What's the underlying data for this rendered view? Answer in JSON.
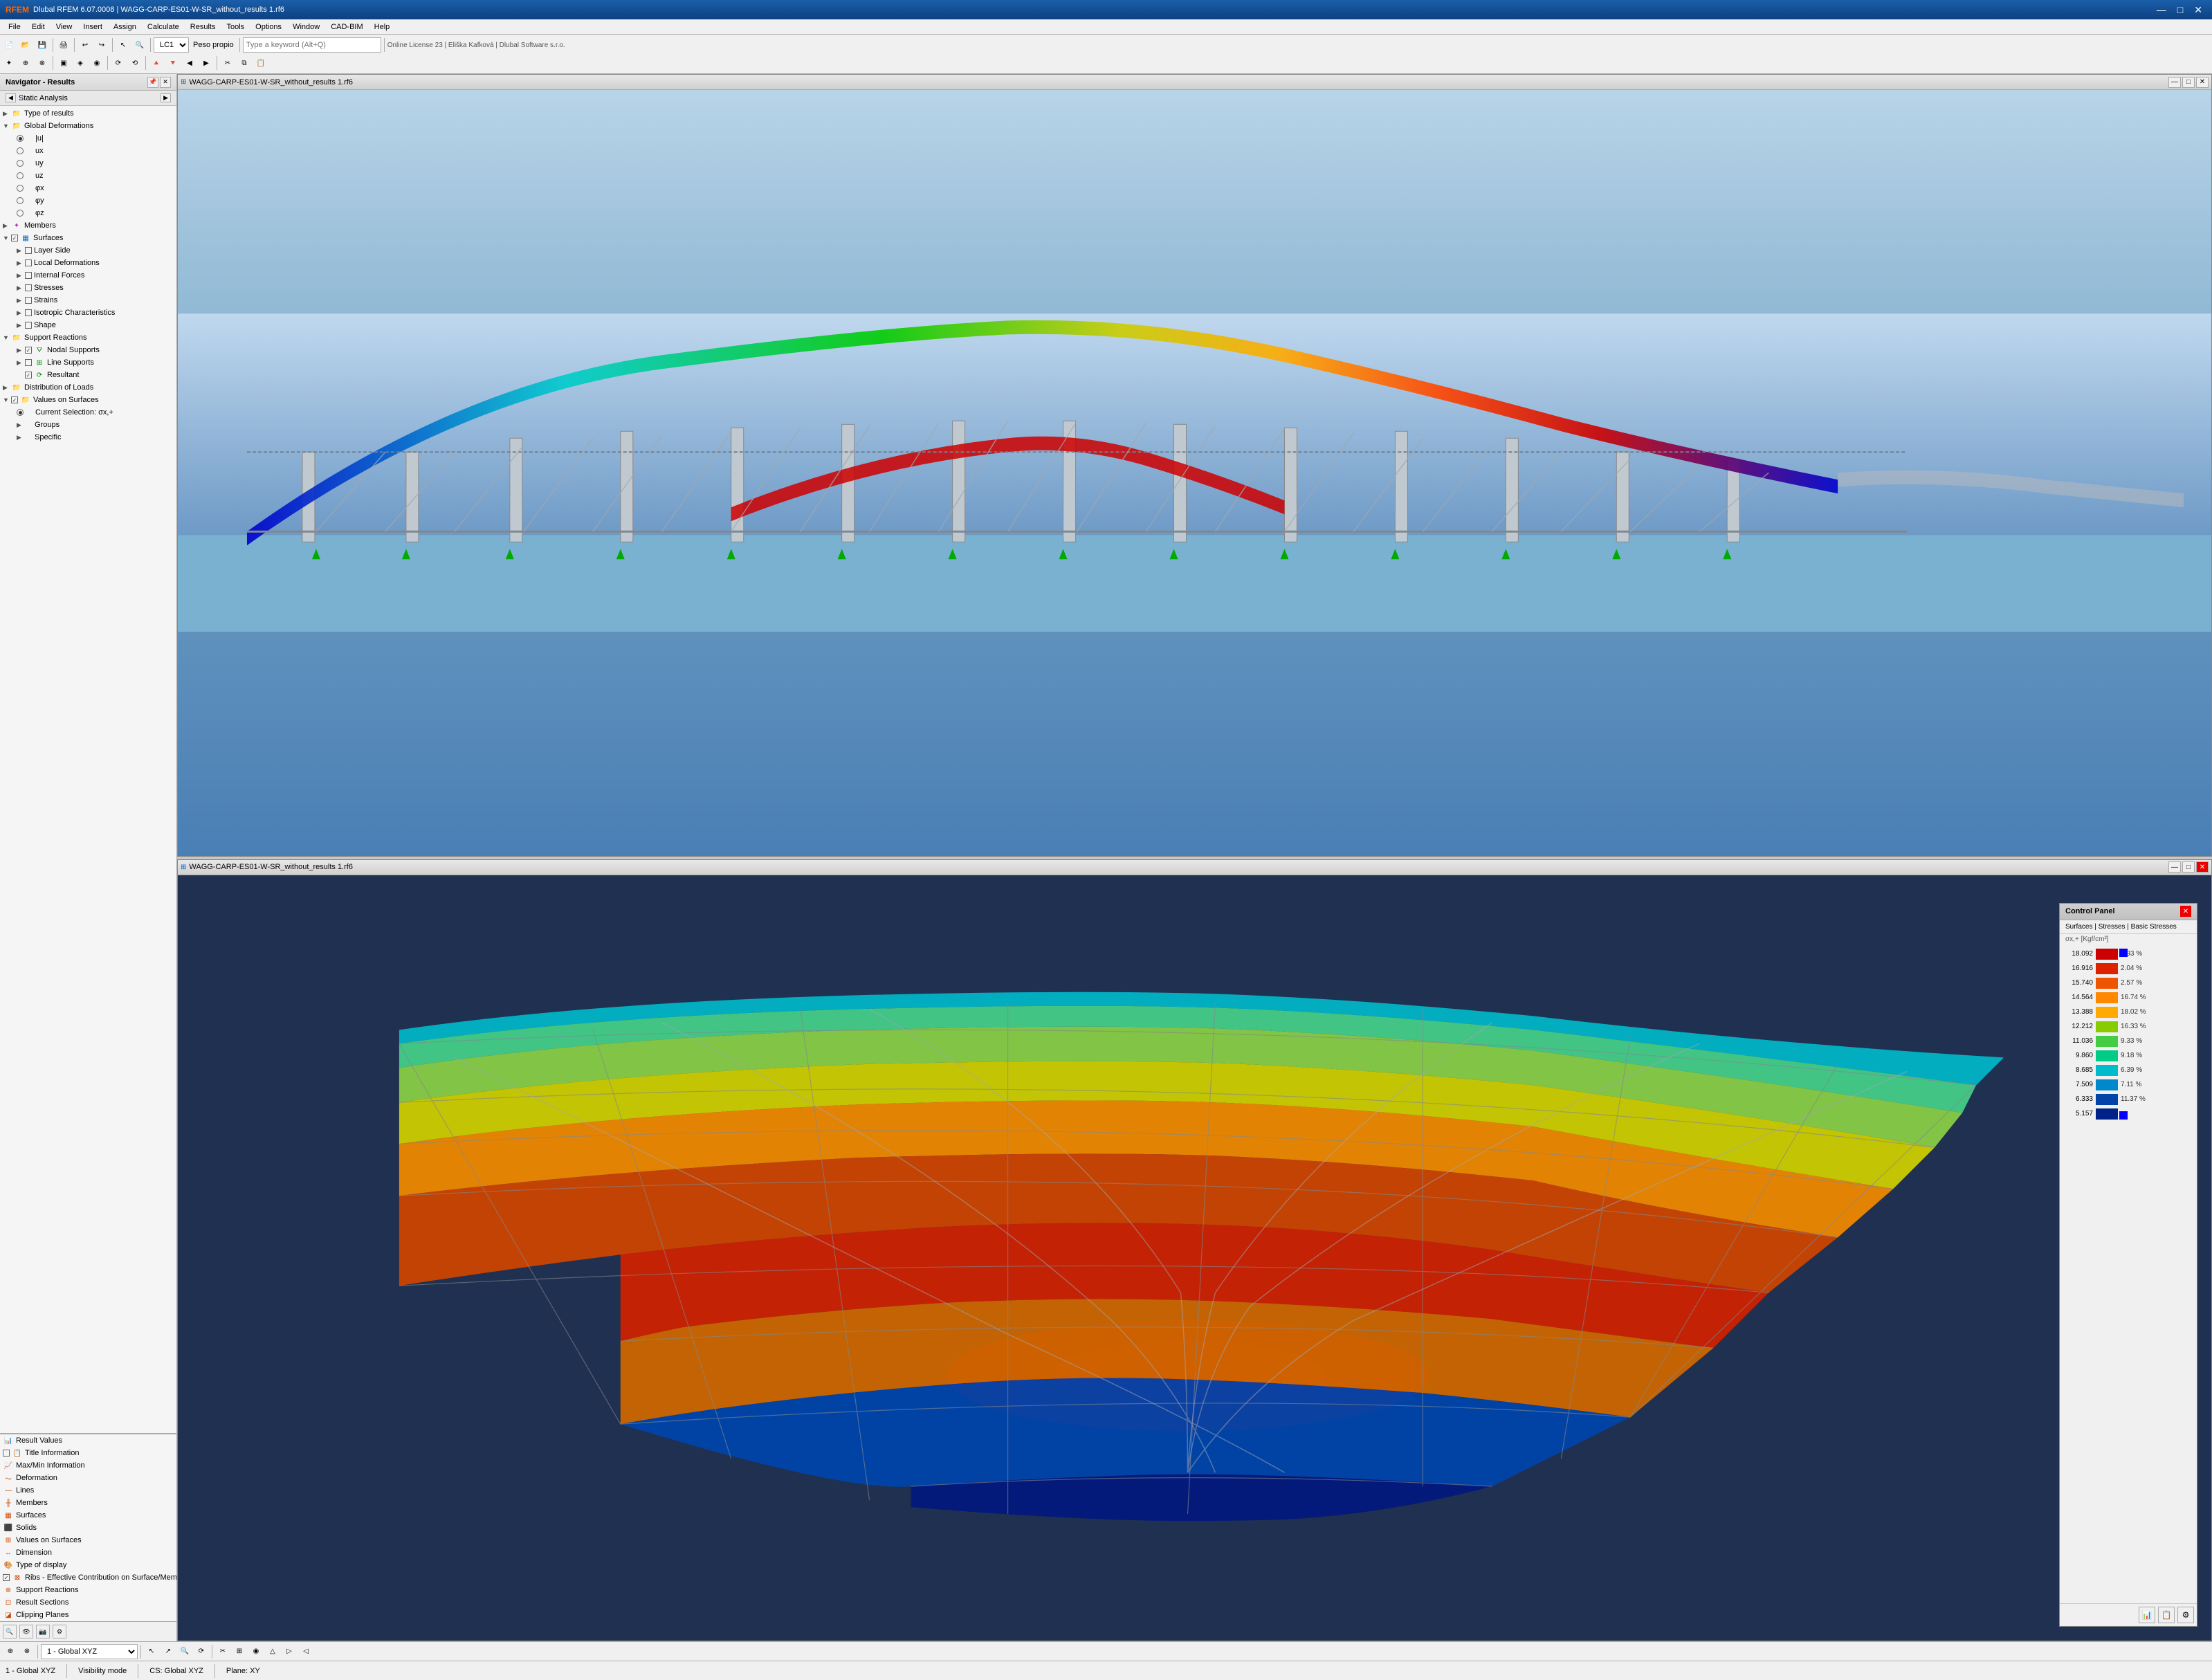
{
  "titleBar": {
    "icon": "🔷",
    "title": "Dlubal RFEM 6.07.0008 | WAGG-CARP-ES01-W-SR_without_results 1.rf6",
    "minimize": "—",
    "maximize": "□",
    "close": "✕"
  },
  "menuBar": {
    "items": [
      "File",
      "Edit",
      "View",
      "Insert",
      "Assign",
      "Calculate",
      "Results",
      "Tools",
      "Options",
      "Window",
      "CAD-BIM",
      "Help"
    ]
  },
  "toolbar": {
    "loadCase": "LC1",
    "loadCaseLabel": "Peso propio",
    "searchPlaceholder": "Type a keyword (Alt+Q)",
    "licenseInfo": "Online License 23 | Eliška Kafková | Dlubal Software s.r.o."
  },
  "navigator": {
    "title": "Navigator - Results",
    "subTitle": "Static Analysis",
    "tree": [
      {
        "id": "type-of-results",
        "label": "Type of results",
        "level": 0,
        "arrow": "▶",
        "hasIcon": true,
        "iconType": "folder"
      },
      {
        "id": "global-deformations",
        "label": "Global Deformations",
        "level": 0,
        "arrow": "▼",
        "hasIcon": true,
        "iconType": "folder",
        "expanded": true
      },
      {
        "id": "deform-u",
        "label": "|u|",
        "level": 1,
        "radio": true,
        "checked": true
      },
      {
        "id": "deform-ux",
        "label": "ux",
        "level": 1,
        "radio": true,
        "checked": false
      },
      {
        "id": "deform-uy",
        "label": "uy",
        "level": 1,
        "radio": true,
        "checked": false
      },
      {
        "id": "deform-uz",
        "label": "uz",
        "level": 1,
        "radio": true,
        "checked": false
      },
      {
        "id": "deform-px",
        "label": "φx",
        "level": 1,
        "radio": true,
        "checked": false
      },
      {
        "id": "deform-py",
        "label": "φy",
        "level": 1,
        "radio": true,
        "checked": false
      },
      {
        "id": "deform-pz",
        "label": "φz",
        "level": 1,
        "radio": true,
        "checked": false
      },
      {
        "id": "members",
        "label": "Members",
        "level": 0,
        "arrow": "▶",
        "hasIcon": true,
        "iconType": "folder"
      },
      {
        "id": "surfaces",
        "label": "Surfaces",
        "level": 0,
        "arrow": "▼",
        "hasIcon": true,
        "iconType": "folder",
        "expanded": true,
        "checked": true,
        "checkbox": true
      },
      {
        "id": "layer-side",
        "label": "Layer Side",
        "level": 1,
        "arrow": "▶",
        "checkbox": true
      },
      {
        "id": "local-deformations",
        "label": "Local Deformations",
        "level": 1,
        "arrow": "▶",
        "checkbox": true
      },
      {
        "id": "internal-forces",
        "label": "Internal Forces",
        "level": 1,
        "arrow": "▶",
        "checkbox": true
      },
      {
        "id": "stresses",
        "label": "Stresses",
        "level": 1,
        "arrow": "▶",
        "checkbox": true
      },
      {
        "id": "strains",
        "label": "Strains",
        "level": 1,
        "arrow": "▶",
        "checkbox": true
      },
      {
        "id": "isotropic-char",
        "label": "Isotropic Characteristics",
        "level": 1,
        "arrow": "▶",
        "checkbox": true
      },
      {
        "id": "shape",
        "label": "Shape",
        "level": 1,
        "arrow": "▶",
        "checkbox": true
      },
      {
        "id": "support-reactions",
        "label": "Support Reactions",
        "level": 0,
        "arrow": "▼",
        "hasIcon": true,
        "iconType": "folder",
        "expanded": true
      },
      {
        "id": "nodal-supports",
        "label": "Nodal Supports",
        "level": 1,
        "arrow": "▶",
        "checkbox": true,
        "checked": true
      },
      {
        "id": "line-supports",
        "label": "Line Supports",
        "level": 1,
        "arrow": "▶",
        "checkbox": true
      },
      {
        "id": "resultant",
        "label": "Resultant",
        "level": 1,
        "checkbox": true,
        "checked": true
      },
      {
        "id": "distribution-of-loads",
        "label": "Distribution of Loads",
        "level": 0,
        "arrow": "▶",
        "hasIcon": true,
        "iconType": "folder"
      },
      {
        "id": "values-on-surfaces",
        "label": "Values on Surfaces",
        "level": 0,
        "arrow": "▼",
        "hasIcon": true,
        "iconType": "folder",
        "expanded": true,
        "checked": true,
        "checkbox": true
      },
      {
        "id": "current-selection",
        "label": "Current Selection: σx,+",
        "level": 1,
        "radio": true,
        "checked": true
      },
      {
        "id": "groups",
        "label": "Groups",
        "level": 1,
        "arrow": "▶"
      },
      {
        "id": "specific",
        "label": "Specific",
        "level": 1,
        "arrow": "▶"
      }
    ]
  },
  "bottomNav": {
    "items": [
      {
        "id": "result-values",
        "label": "Result Values",
        "checkbox": false,
        "checked": false
      },
      {
        "id": "title-information",
        "label": "Title Information",
        "checkbox": true,
        "checked": false
      },
      {
        "id": "maxmin-information",
        "label": "Max/Min Information",
        "checkbox": false,
        "checked": false
      },
      {
        "id": "deformation",
        "label": "Deformation",
        "checkbox": false,
        "checked": false
      },
      {
        "id": "lines",
        "label": "Lines",
        "checkbox": false,
        "checked": false
      },
      {
        "id": "members",
        "label": "Members",
        "checkbox": false,
        "checked": false
      },
      {
        "id": "surfaces",
        "label": "Surfaces",
        "checkbox": false,
        "checked": false
      },
      {
        "id": "solids",
        "label": "Solids",
        "checkbox": false,
        "checked": false
      },
      {
        "id": "values-on-surfaces",
        "label": "Values on Surfaces",
        "checkbox": false,
        "checked": false
      },
      {
        "id": "dimension",
        "label": "Dimension",
        "checkbox": false,
        "checked": false
      },
      {
        "id": "type-of-display",
        "label": "Type of display",
        "checkbox": false,
        "checked": false
      },
      {
        "id": "ribs-effective",
        "label": "Ribs - Effective Contribution on Surface/Member",
        "checkbox": true,
        "checked": true
      },
      {
        "id": "support-reactions-bottom",
        "label": "Support Reactions",
        "checkbox": false,
        "checked": false
      },
      {
        "id": "result-sections",
        "label": "Result Sections",
        "checkbox": false,
        "checked": false
      },
      {
        "id": "clipping-planes",
        "label": "Clipping Planes",
        "checkbox": false,
        "checked": false
      }
    ]
  },
  "viewport1": {
    "title": "WAGG-CARP-ES01-W-SR_without_results 1.rf6"
  },
  "viewport2": {
    "title": "WAGG-CARP-ES01-W-SR_without_results 1.rf6"
  },
  "controlPanel": {
    "title": "Control Panel",
    "closeBtn": "✕",
    "subtitle": "Surfaces | Stresses | Basic Stresses",
    "valueLabel": "σx,+ [Kgf/cm²]",
    "colorScale": [
      {
        "value": "18.092",
        "color": "#cc0000",
        "percent": "0.93 %",
        "topIndicator": true
      },
      {
        "value": "16.916",
        "color": "#dd2200",
        "percent": "2.04 %"
      },
      {
        "value": "15.740",
        "color": "#ee5500",
        "percent": "2.57 %"
      },
      {
        "value": "14.564",
        "color": "#ff8800",
        "percent": "16.74 %"
      },
      {
        "value": "13.388",
        "color": "#ffaa00",
        "percent": "18.02 %"
      },
      {
        "value": "12.212",
        "color": "#88cc00",
        "percent": "16.33 %"
      },
      {
        "value": "11.036",
        "color": "#44cc44",
        "percent": "9.33 %"
      },
      {
        "value": "9.860",
        "color": "#00cc88",
        "percent": "9.18 %"
      },
      {
        "value": "8.685",
        "color": "#00bbcc",
        "percent": "6.39 %"
      },
      {
        "value": "7.509",
        "color": "#0088cc",
        "percent": "7.11 %"
      },
      {
        "value": "6.333",
        "color": "#0044aa",
        "percent": "11.37 %"
      },
      {
        "value": "5.157",
        "color": "#002288",
        "percent": "",
        "bottomIndicator": true
      }
    ],
    "footerBtns": [
      "📊",
      "📋",
      "⚙"
    ]
  },
  "statusBar": {
    "workspaceName": "1 - Global XYZ",
    "visibilityMode": "Visibility mode",
    "csLabel": "CS: Global XYZ",
    "planeLabel": "Plane: XY"
  }
}
